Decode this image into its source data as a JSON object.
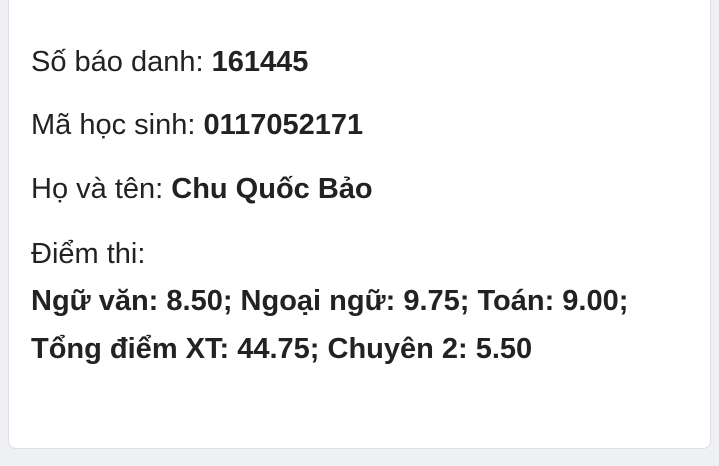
{
  "student": {
    "sbd_label": "Số báo danh: ",
    "sbd_value": "161445",
    "mahs_label": "Mã học sinh: ",
    "mahs_value": "0117052171",
    "name_label": "Họ và tên: ",
    "name_value": "Chu Quốc Bảo",
    "scores_label": "Điểm thi:",
    "scores_line1": "Ngữ văn: 8.50; Ngoại ngữ: 9.75; Toán: 9.00;",
    "scores_line2": "Tổng điểm XT: 44.75; Chuyên 2: 5.50"
  }
}
